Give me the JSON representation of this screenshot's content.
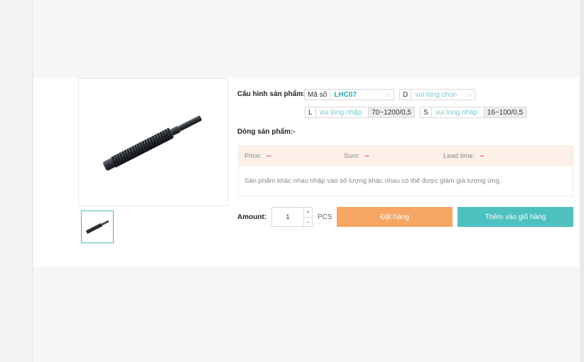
{
  "config": {
    "label": "Cấu hình sản phẩm:",
    "code_prefix": "Mã số",
    "code_value": "LHC07",
    "d_prefix": "D",
    "d_placeholder": "vui lòng chọn",
    "l_prefix": "L",
    "l_placeholder": "vui lòng nhập",
    "l_range": "70~1200/0,5",
    "s_prefix": "S",
    "s_placeholder": "vui lòng nhập",
    "s_range": "16~100/0,5"
  },
  "product_line": {
    "label": "Dòng sản phẩm:",
    "value": "-"
  },
  "pricing": {
    "price_label": "Price:",
    "price_value": "--",
    "sum_label": "Sum:",
    "sum_value": "--",
    "lead_label": "Lead time:",
    "lead_value": "--",
    "note": "Sản phẩm khác nhau nhập vào số lượng khác nhau có thể được giảm giá tương ứng."
  },
  "order": {
    "amount_label": "Amount:",
    "quantity": "1",
    "plus": "+",
    "minus": "−",
    "unit": "PCS",
    "order_button": "Đặt hàng",
    "cart_button": "Thêm vào giỏ hàng"
  },
  "icons": {
    "dropdown": "chevron-down-icon"
  },
  "colors": {
    "accent": "#2aa7b0",
    "order": "#f6a764",
    "cart": "#4ec0c0",
    "price_bg": "#fdf0e8"
  }
}
